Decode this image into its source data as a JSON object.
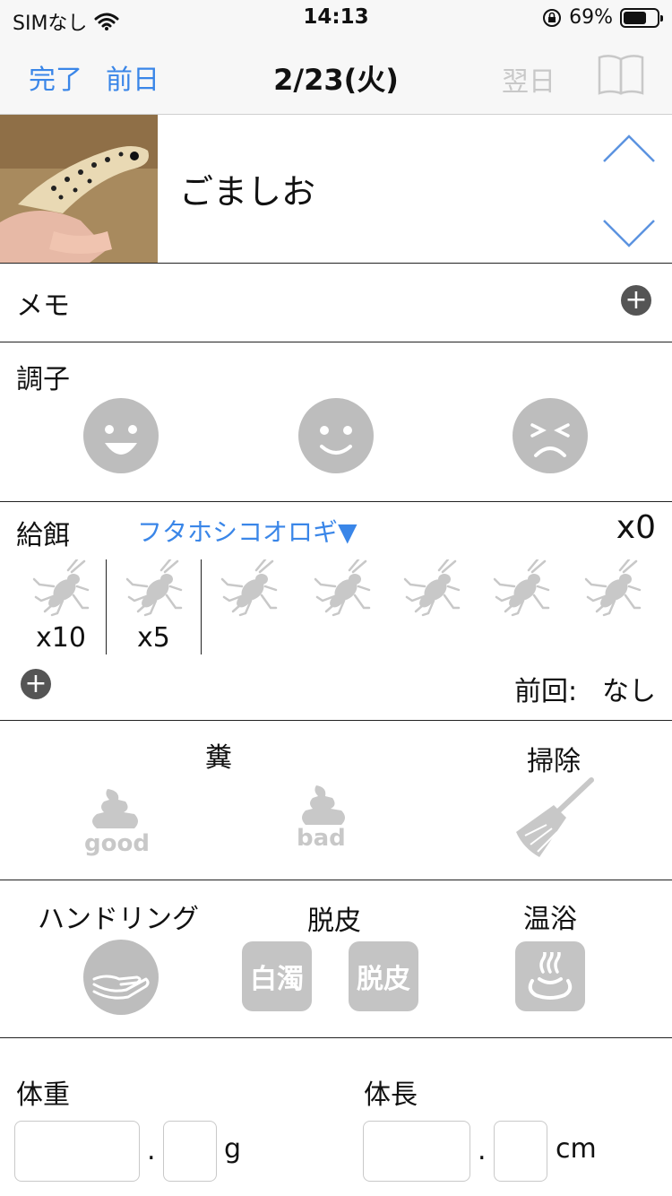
{
  "status": {
    "carrier": "SIMなし",
    "time": "14:13",
    "battery": "69%",
    "battery_level": 0.69
  },
  "nav": {
    "done": "完了",
    "prev": "前日",
    "title": "2/23(火)",
    "next": "翌日",
    "book_icon": "book-icon"
  },
  "pet": {
    "name": "ごましお"
  },
  "memo": {
    "label": "メモ"
  },
  "condition": {
    "label": "調子",
    "faces": [
      "smile-face-icon",
      "content-face-icon",
      "sad-face-icon"
    ]
  },
  "feeding": {
    "label": "給餌",
    "food": "フタホシコオロギ▼",
    "count": "x0",
    "presets": [
      "x10",
      "x5"
    ],
    "last_label": "前回:",
    "last_value": "なし"
  },
  "droppings": {
    "label": "糞",
    "good": "good",
    "bad": "bad",
    "cleaning": "掃除"
  },
  "care": {
    "handling": "ハンドリング",
    "shedding": "脱皮",
    "shed_white": "白濁",
    "shed_done": "脱皮",
    "bath": "温浴"
  },
  "measure": {
    "weight": "体重",
    "weight_unit": "g",
    "length": "体長",
    "length_unit": "cm",
    "dot": "."
  },
  "colors": {
    "accent": "#3a86e8",
    "icon_gray": "#bdbdbd"
  }
}
